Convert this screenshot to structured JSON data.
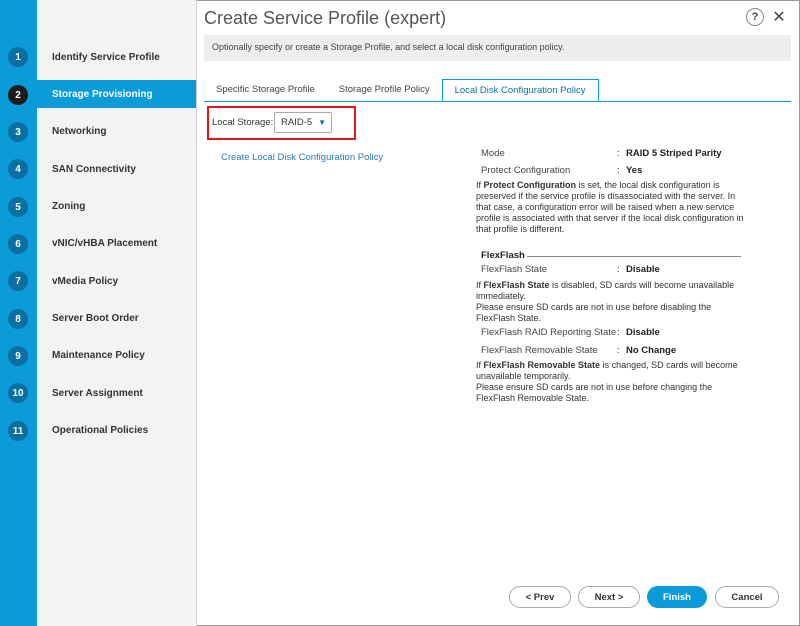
{
  "header": {
    "title": "Create Service Profile (expert)",
    "description": "Optionally specify or create a Storage Profile, and select a local disk configuration policy.",
    "help_icon": "?",
    "close_icon": "✕"
  },
  "steps": [
    {
      "num": "1",
      "label": "Identify Service Profile"
    },
    {
      "num": "2",
      "label": "Storage Provisioning"
    },
    {
      "num": "3",
      "label": "Networking"
    },
    {
      "num": "4",
      "label": "SAN Connectivity"
    },
    {
      "num": "5",
      "label": "Zoning"
    },
    {
      "num": "6",
      "label": "vNIC/vHBA Placement"
    },
    {
      "num": "7",
      "label": "vMedia Policy"
    },
    {
      "num": "8",
      "label": "Server Boot Order"
    },
    {
      "num": "9",
      "label": "Maintenance Policy"
    },
    {
      "num": "10",
      "label": "Server Assignment"
    },
    {
      "num": "11",
      "label": "Operational Policies"
    }
  ],
  "active_step": "Storage Provisioning",
  "tabs": [
    "Specific Storage Profile",
    "Storage Profile Policy",
    "Local Disk Configuration Policy"
  ],
  "active_tab": "Local Disk Configuration Policy",
  "local_storage": {
    "label": "Local Storage:",
    "value": "RAID-5"
  },
  "create_link": "Create Local Disk Configuration Policy",
  "details": {
    "mode_label": "Mode",
    "mode_value": "RAID 5 Striped Parity",
    "protect_label": "Protect Configuration",
    "protect_value": "Yes",
    "protect_note_1": "If ",
    "protect_note_bold": "Protect Configuration",
    "protect_note_2": " is set, the local disk configuration is preserved if the service profile is disassociated with the server. In that case, a configuration error will be raised when a new service profile is associated with that server if the local disk configuration in that profile is different.",
    "flexflash_heading": "FlexFlash",
    "ff_state_label": "FlexFlash State",
    "ff_state_value": "Disable",
    "ff_state_note_1": "If ",
    "ff_state_note_bold": "FlexFlash State",
    "ff_state_note_2": " is disabled, SD cards will become unavailable immediately.",
    "ff_state_note_3": "Please ensure SD cards are not in use before disabling the FlexFlash State.",
    "ff_raid_label": "FlexFlash RAID Reporting State",
    "ff_raid_value": "Disable",
    "ff_removable_label": "FlexFlash Removable State",
    "ff_removable_value": "No Change",
    "ff_rem_note_1": "If ",
    "ff_rem_note_bold": "FlexFlash Removable State",
    "ff_rem_note_2": " is changed, SD cards will become unavailable temporarily.",
    "ff_rem_note_3": "Please ensure SD cards are not in use before changing the FlexFlash Removable State.",
    "colon": ":"
  },
  "footer": {
    "prev": "< Prev",
    "next": "Next >",
    "finish": "Finish",
    "cancel": "Cancel"
  },
  "colors": {
    "accent": "#0a9bd8",
    "highlight_box": "#e01818"
  }
}
